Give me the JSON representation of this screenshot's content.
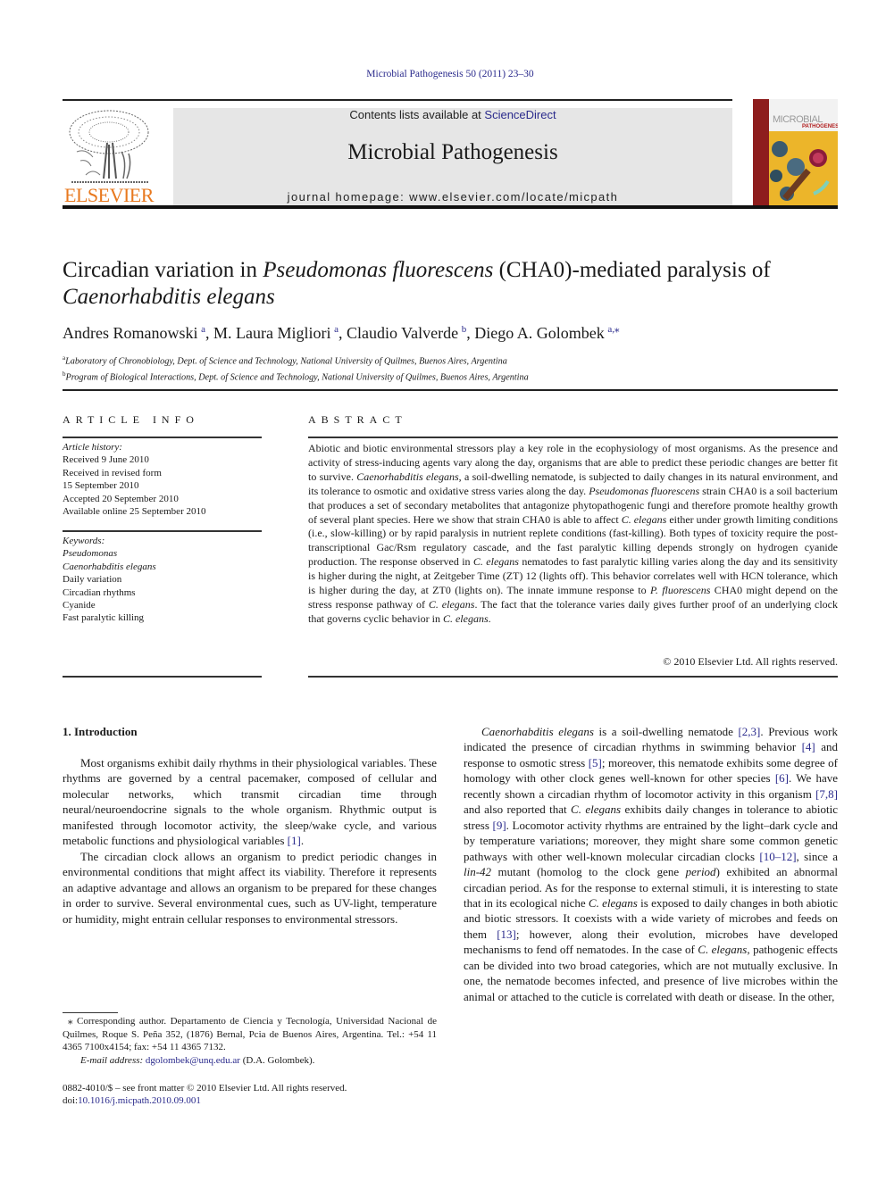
{
  "header": {
    "citation": "Microbial Pathogenesis 50 (2011) 23–30",
    "contents_prefix": "Contents lists available at ",
    "contents_link": "ScienceDirect",
    "journal_name": "Microbial Pathogenesis",
    "homepage_prefix": "journal homepage: ",
    "homepage_url": "www.elsevier.com/locate/micpath",
    "publisher_logo": "ELSEVIER",
    "cover_title_1": "MICROBIAL",
    "cover_title_2": "PATHOGENESIS"
  },
  "article": {
    "title_part1": "Circadian variation in ",
    "title_italic1": "Pseudomonas fluorescens",
    "title_part2": " (CHA0)-mediated paralysis of",
    "title_italic2": "Caenorhabditis elegans",
    "authors": [
      {
        "name": "Andres Romanowski",
        "aff": "a",
        "sep": ", "
      },
      {
        "name": "M. Laura Migliori",
        "aff": "a",
        "sep": ", "
      },
      {
        "name": "Claudio Valverde",
        "aff": "b",
        "sep": ", "
      },
      {
        "name": "Diego A. Golombek",
        "aff": "a,⁎",
        "sep": ""
      }
    ],
    "affiliations": [
      {
        "mark": "a",
        "text": "Laboratory of Chronobiology, Dept. of Science and Technology, National University of Quilmes, Buenos Aires, Argentina"
      },
      {
        "mark": "b",
        "text": "Program of Biological Interactions, Dept. of Science and Technology, National University of Quilmes, Buenos Aires, Argentina"
      }
    ]
  },
  "article_info": {
    "heading": "ARTICLE INFO",
    "history_label": "Article history:",
    "history": [
      "Received 9 June 2010",
      "Received in revised form",
      "15 September 2010",
      "Accepted 20 September 2010",
      "Available online 25 September 2010"
    ],
    "keywords_label": "Keywords:",
    "keywords": [
      {
        "text": "Pseudomonas",
        "italic": true
      },
      {
        "text": "Caenorhabditis elegans",
        "italic": true
      },
      {
        "text": "Daily variation",
        "italic": false
      },
      {
        "text": "Circadian rhythms",
        "italic": false
      },
      {
        "text": "Cyanide",
        "italic": false
      },
      {
        "text": "Fast paralytic killing",
        "italic": false
      }
    ]
  },
  "abstract": {
    "heading": "ABSTRACT",
    "segments": [
      {
        "t": "Abiotic and biotic environmental stressors play a key role in the ecophysiology of most organisms. As the presence and activity of stress-inducing agents vary along the day, organisms that are able to predict these periodic changes are better fit to survive. "
      },
      {
        "t": "Caenorhabditis elegans",
        "i": true
      },
      {
        "t": ", a soil-dwelling nematode, is subjected to daily changes in its natural environment, and its tolerance to osmotic and oxidative stress varies along the day. "
      },
      {
        "t": "Pseudomonas fluorescens",
        "i": true
      },
      {
        "t": " strain CHA0 is a soil bacterium that produces a set of secondary metabolites that antagonize phytopathogenic fungi and therefore promote healthy growth of several plant species. Here we show that strain CHA0 is able to affect "
      },
      {
        "t": "C. elegans",
        "i": true
      },
      {
        "t": " either under growth limiting conditions (i.e., slow-killing) or by rapid paralysis in nutrient replete conditions (fast-killing). Both types of toxicity require the post-transcriptional Gac/Rsm regulatory cascade, and the fast paralytic killing depends strongly on hydrogen cyanide production. The response observed in "
      },
      {
        "t": "C. elegans",
        "i": true
      },
      {
        "t": " nema­todes to fast paralytic killing varies along the day and its sensitivity is higher during the night, at Zeit­geber Time (ZT) 12 (lights off). This behavior correlates well with HCN tolerance, which is higher during the day, at ZT0 (lights on). The innate immune response to "
      },
      {
        "t": "P. fluorescens",
        "i": true
      },
      {
        "t": " CHA0 might depend on the stress response pathway of "
      },
      {
        "t": "C. elegans",
        "i": true
      },
      {
        "t": ". The fact that the tolerance varies daily gives further proof of an underlying clock that governs cyclic behavior in "
      },
      {
        "t": "C. elegans",
        "i": true
      },
      {
        "t": "."
      }
    ],
    "copyright": "© 2010 Elsevier Ltd. All rights reserved."
  },
  "intro": {
    "heading": "1.  Introduction",
    "left_paragraphs": [
      [
        {
          "t": "Most organisms exhibit daily rhythms in their physiological variables. These rhythms are governed by a central pacemaker, composed of cellular and molecular networks, which transmit circadian time through neural/neuroendocrine signals to the whole organism. Rhythmic output is manifested through locomotor activity, the sleep/wake cycle, and various metabolic functions and physio­logical variables "
        },
        {
          "t": "[1]",
          "ref": true
        },
        {
          "t": "."
        }
      ],
      [
        {
          "t": "The circadian clock allows an organism to predict periodic changes in environmental conditions that might affect its viability. Therefore it represents an adaptive advantage and allows an organism to be prepared for these changes in order to survive. Several environmental cues, such as UV-light, temperature or humidity, might entrain cellular responses to environmental stressors."
        }
      ]
    ],
    "right_paragraphs": [
      [
        {
          "t": "Caenorhabditis elegans",
          "i": true
        },
        {
          "t": " is a soil-dwelling nematode "
        },
        {
          "t": "[2,3]",
          "ref": true
        },
        {
          "t": ". Previous work indicated the presence of circadian rhythms in swimming behavior "
        },
        {
          "t": "[4]",
          "ref": true
        },
        {
          "t": " and response to osmotic stress "
        },
        {
          "t": "[5]",
          "ref": true
        },
        {
          "t": "; moreover, this nematode exhibits some degree of homology with other clock genes well-known for other species "
        },
        {
          "t": "[6]",
          "ref": true
        },
        {
          "t": ". We have recently shown a circadian rhythm of locomotor activity in this organism "
        },
        {
          "t": "[7,8]",
          "ref": true
        },
        {
          "t": " and also reported that "
        },
        {
          "t": "C. elegans",
          "i": true
        },
        {
          "t": " exhibits daily changes in tolerance to abiotic stress "
        },
        {
          "t": "[9]",
          "ref": true
        },
        {
          "t": ". Locomotor activity rhythms are entrained by the light–dark cycle and by temperature variations; moreover, they might share some common genetic pathways with other well-known molecular circadian clocks "
        },
        {
          "t": "[10–12]",
          "ref": true
        },
        {
          "t": ", since a "
        },
        {
          "t": "lin-42",
          "i": true
        },
        {
          "t": " mutant (homolog to the clock gene "
        },
        {
          "t": "period",
          "i": true
        },
        {
          "t": ") exhibited an abnormal circadian period. As for the response to external stimuli, it is interesting to state that in its ecological niche "
        },
        {
          "t": "C. elegans",
          "i": true
        },
        {
          "t": " is exposed to daily changes in both abiotic and biotic stressors. It coexists with a wide variety of microbes and feeds on them "
        },
        {
          "t": "[13]",
          "ref": true
        },
        {
          "t": "; however, along their evolution, microbes have devel­oped mechanisms to fend off nematodes. In the case of "
        },
        {
          "t": "C. elegans",
          "i": true
        },
        {
          "t": ", pathogenic effects can be divided into two broad categories, which are not mutually exclusive. In one, the nematode becomes infec­ted, and presence of live microbes within the animal or attached to the cuticle is correlated with death or disease. In the other,"
        }
      ]
    ]
  },
  "footnote": {
    "corresponding": "⁎ Corresponding author. Departamento de Ciencia y Tecnología, Universidad Nacional de Quilmes, Roque S. Peña 352, (1876) Bernal, Pcia de Buenos Aires, Argentina. Tel.: +54 11 4365 7100x4154; fax: +54 11 4365 7132.",
    "email_label": "E-mail address: ",
    "email": "dgolombek@unq.edu.ar",
    "email_suffix": " (D.A. Golombek)."
  },
  "front_matter": {
    "issn_line": "0882-4010/$ – see front matter © 2010 Elsevier Ltd. All rights reserved.",
    "doi_label": "doi:",
    "doi": "10.1016/j.micpath.2010.09.001"
  }
}
